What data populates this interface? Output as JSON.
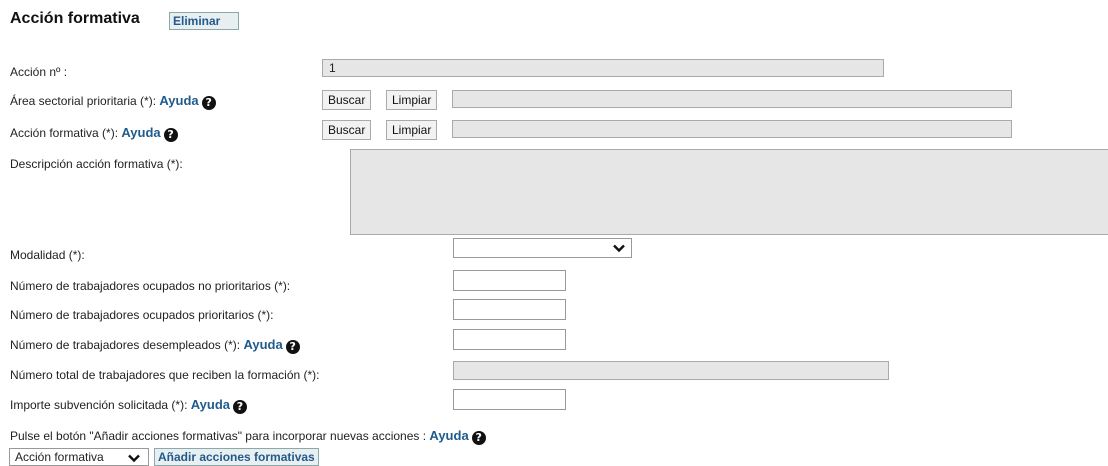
{
  "header": {
    "title": "Acción formativa",
    "delete_label": "Eliminar"
  },
  "fields": {
    "accion_num": {
      "label": "Acción nº :",
      "value": "1"
    },
    "area": {
      "label": "Área sectorial prioritaria (*): ",
      "help": "Ayuda",
      "search": "Buscar",
      "clear": "Limpiar",
      "value": ""
    },
    "accion": {
      "label": "Acción formativa (*): ",
      "help": "Ayuda",
      "search": "Buscar",
      "clear": "Limpiar",
      "value": ""
    },
    "descripcion": {
      "label": "Descripción acción formativa (*):",
      "value": ""
    },
    "modalidad": {
      "label": "Modalidad (*):",
      "value": ""
    },
    "no_prioritarios": {
      "label": "Número de trabajadores ocupados no prioritarios (*):",
      "value": ""
    },
    "prioritarios": {
      "label": "Número de trabajadores ocupados prioritarios (*):",
      "value": ""
    },
    "desempleados": {
      "label": "Número de trabajadores desempleados (*): ",
      "help": "Ayuda",
      "value": ""
    },
    "total": {
      "label": "Número total de trabajadores que reciben la formación (*):",
      "value": ""
    },
    "importe": {
      "label": "Importe subvención solicitada (*): ",
      "help": "Ayuda",
      "value": ""
    }
  },
  "footer": {
    "note": "Pulse el botón \"Añadir acciones formativas\" para incorporar nuevas acciones : ",
    "help": "Ayuda",
    "type_select": "Acción formativa",
    "add_label": "Añadir acciones formativas"
  },
  "icons": {
    "help": "question-circle-icon",
    "dropdown": "chevron-down-icon"
  }
}
